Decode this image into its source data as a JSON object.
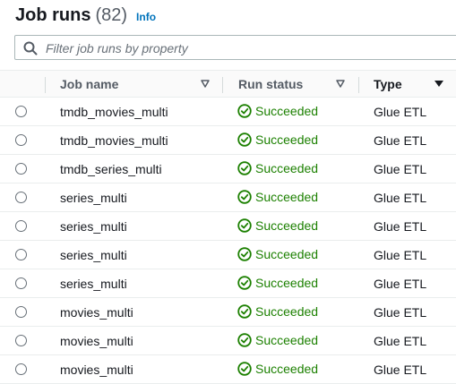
{
  "header": {
    "title": "Job runs",
    "count": "(82)",
    "info": "Info"
  },
  "search": {
    "placeholder": "Filter job runs by property",
    "value": ""
  },
  "columns": {
    "job_name": "Job name",
    "run_status": "Run status",
    "type": "Type"
  },
  "colors": {
    "success": "#1d8102",
    "link": "#0073bb"
  },
  "icons": {
    "search": "search-icon",
    "status": "success-check-circle-icon",
    "sort": "caret-down-icon"
  },
  "rows": [
    {
      "job_name": "tmdb_movies_multi",
      "status": "Succeeded",
      "type": "Glue ETL"
    },
    {
      "job_name": "tmdb_movies_multi",
      "status": "Succeeded",
      "type": "Glue ETL"
    },
    {
      "job_name": "tmdb_series_multi",
      "status": "Succeeded",
      "type": "Glue ETL"
    },
    {
      "job_name": "series_multi",
      "status": "Succeeded",
      "type": "Glue ETL"
    },
    {
      "job_name": "series_multi",
      "status": "Succeeded",
      "type": "Glue ETL"
    },
    {
      "job_name": "series_multi",
      "status": "Succeeded",
      "type": "Glue ETL"
    },
    {
      "job_name": "series_multi",
      "status": "Succeeded",
      "type": "Glue ETL"
    },
    {
      "job_name": "movies_multi",
      "status": "Succeeded",
      "type": "Glue ETL"
    },
    {
      "job_name": "movies_multi",
      "status": "Succeeded",
      "type": "Glue ETL"
    },
    {
      "job_name": "movies_multi",
      "status": "Succeeded",
      "type": "Glue ETL"
    }
  ]
}
